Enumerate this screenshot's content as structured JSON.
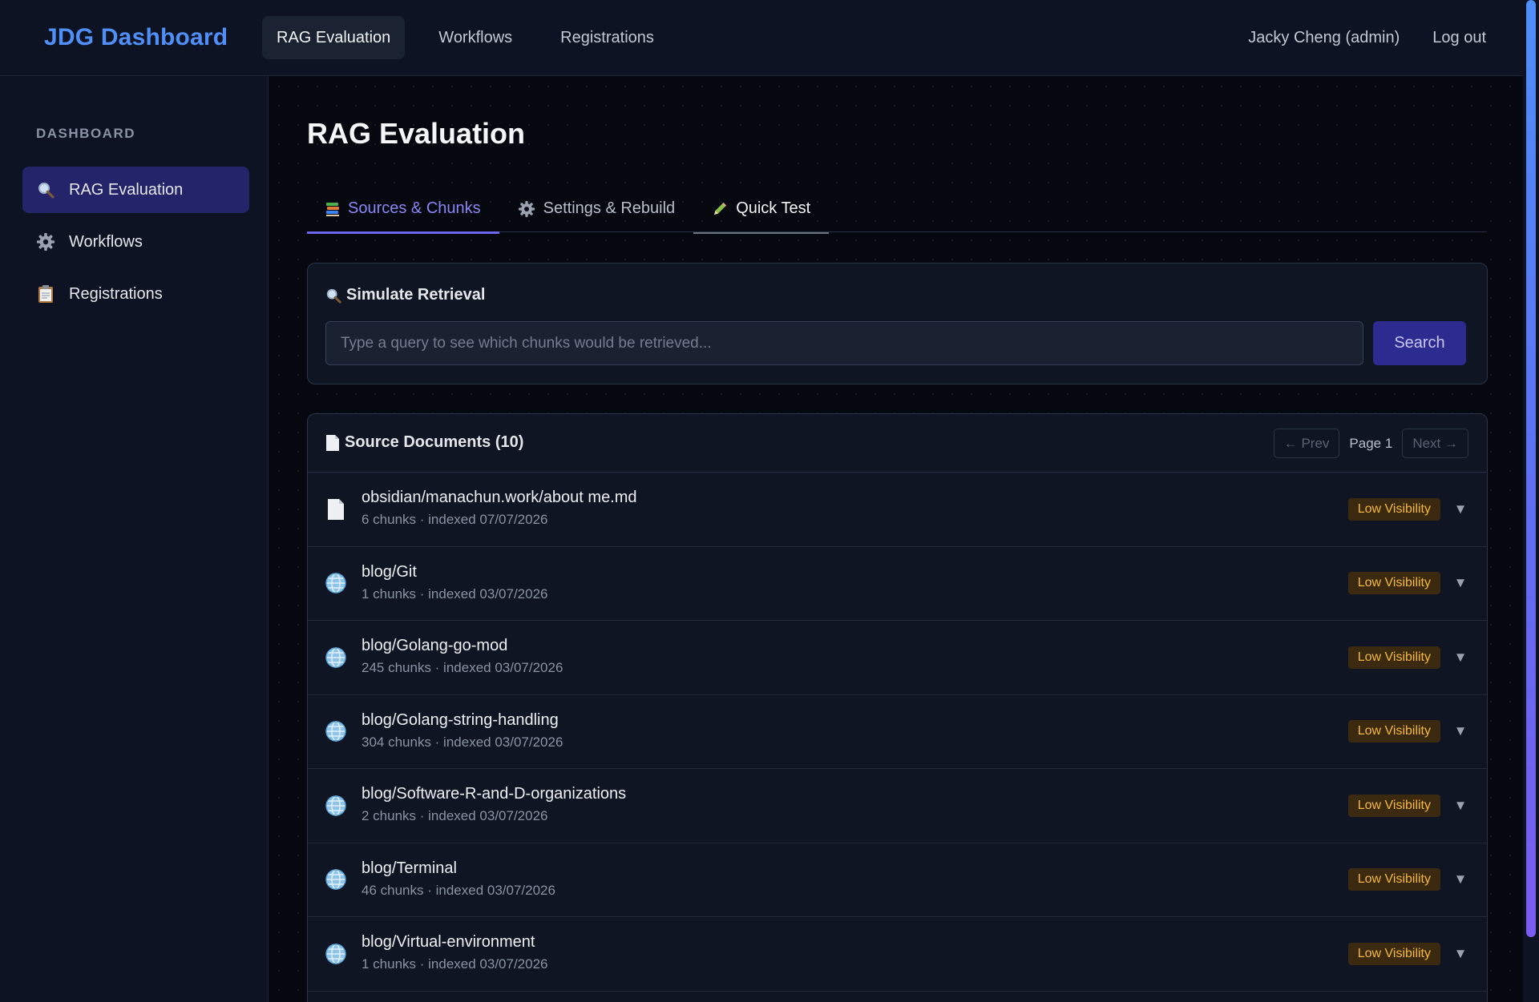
{
  "topnav": {
    "brand": "JDG Dashboard",
    "links": [
      {
        "label": "RAG Evaluation",
        "active": true
      },
      {
        "label": "Workflows",
        "active": false
      },
      {
        "label": "Registrations",
        "active": false
      }
    ],
    "user": "Jacky Cheng (admin)",
    "logout": "Log out"
  },
  "sidebar": {
    "heading": "DASHBOARD",
    "items": [
      {
        "label": "RAG Evaluation",
        "icon": "magnifier-icon",
        "active": true
      },
      {
        "label": "Workflows",
        "icon": "gear-icon",
        "active": false
      },
      {
        "label": "Registrations",
        "icon": "clipboard-icon",
        "active": false
      }
    ]
  },
  "main": {
    "title": "RAG Evaluation",
    "tabs": [
      {
        "label": "Sources & Chunks",
        "icon": "books-icon",
        "state": "active"
      },
      {
        "label": "Settings & Rebuild",
        "icon": "gear-icon",
        "state": "normal"
      },
      {
        "label": "Quick Test",
        "icon": "pencil-icon",
        "state": "focused"
      }
    ],
    "retrieval": {
      "title": "Simulate Retrieval",
      "placeholder": "Type a query to see which chunks would be retrieved...",
      "value": "",
      "search_label": "Search"
    },
    "sources": {
      "title": "Source Documents (10)",
      "prev_label": "← Prev",
      "page_label": "Page 1",
      "next_label": "Next →",
      "documents": [
        {
          "name": "obsidian/manachun.work/about me.md",
          "meta": "6 chunks · indexed 07/07/2026",
          "icon": "document-icon",
          "badge": "Low Visibility"
        },
        {
          "name": "blog/Git",
          "meta": "1 chunks · indexed 03/07/2026",
          "icon": "globe-icon",
          "badge": "Low Visibility"
        },
        {
          "name": "blog/Golang-go-mod",
          "meta": "245 chunks · indexed 03/07/2026",
          "icon": "globe-icon",
          "badge": "Low Visibility"
        },
        {
          "name": "blog/Golang-string-handling",
          "meta": "304 chunks · indexed 03/07/2026",
          "icon": "globe-icon",
          "badge": "Low Visibility"
        },
        {
          "name": "blog/Software-R-and-D-organizations",
          "meta": "2 chunks · indexed 03/07/2026",
          "icon": "globe-icon",
          "badge": "Low Visibility"
        },
        {
          "name": "blog/Terminal",
          "meta": "46 chunks · indexed 03/07/2026",
          "icon": "globe-icon",
          "badge": "Low Visibility"
        },
        {
          "name": "blog/Virtual-environment",
          "meta": "1 chunks · indexed 03/07/2026",
          "icon": "globe-icon",
          "badge": "Low Visibility"
        }
      ]
    }
  },
  "colors": {
    "brand": "#4f8ff7",
    "accent": "#6e64f0",
    "badge_bg": "#3c2a10",
    "badge_text": "#f5b93a",
    "sidebar_active": "#23246a"
  }
}
